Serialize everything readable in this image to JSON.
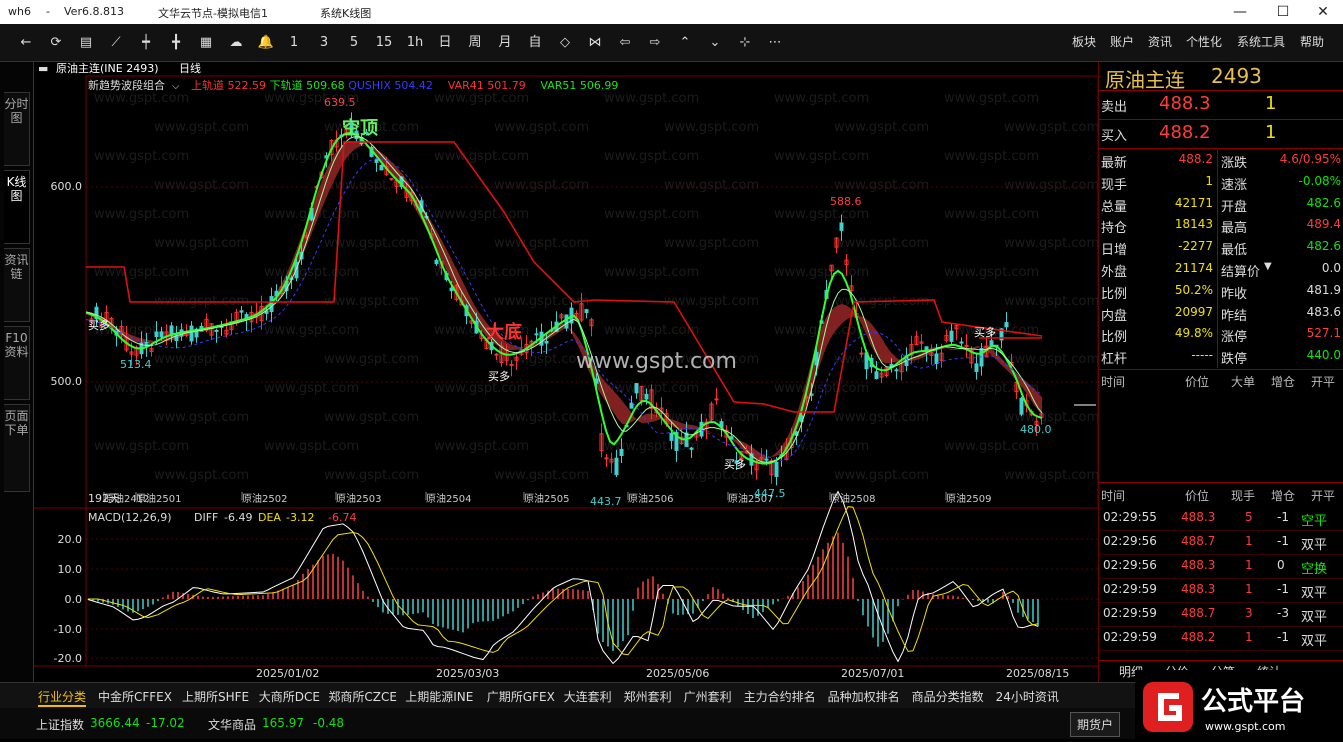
{
  "titlebar": {
    "app": "wh6",
    "sep": "-",
    "version": "Ver6.8.813",
    "server": "文华云节点-模拟电信1",
    "view": "系统K线图"
  },
  "toolbar": {
    "periods": [
      "1",
      "3",
      "5",
      "15",
      "1h",
      "日",
      "周",
      "月",
      "自"
    ],
    "menus": [
      "板块",
      "账户",
      "资讯",
      "个性化",
      "系统工具",
      "帮助"
    ],
    "icons": [
      "back-icon",
      "refresh-icon",
      "list-icon",
      "line-chart-icon",
      "candle-icon",
      "candle2-icon",
      "grid-icon",
      "cloud-icon",
      "bell-icon"
    ],
    "tail_icons": [
      "diamond-left-icon",
      "diamond-right-icon",
      "arrow-left-icon",
      "arrow-right-icon",
      "arrow-up-icon",
      "arrow-down-icon",
      "crosshair-icon",
      "more-icon"
    ]
  },
  "sidetabs": [
    "分时图",
    "K线图",
    "资讯链",
    "F10资料",
    "页面下单"
  ],
  "chart": {
    "symbol": "原油主连(INE 2493)",
    "period": "日线",
    "indicator": "新趋势波段组合",
    "legend": [
      {
        "label": "上轨道",
        "value": "522.59",
        "color": "#ff3030"
      },
      {
        "label": "下轨道",
        "value": "509.68",
        "color": "#20e020"
      },
      {
        "label": "QUSHIX",
        "value": "504.42",
        "color": "#3a3aff"
      },
      {
        "label": "VAR41",
        "value": "501.79",
        "color": "#ff3030"
      },
      {
        "label": "VAR51",
        "value": "506.99",
        "color": "#20e020"
      }
    ],
    "price_labels": [
      "600.0",
      "500.0"
    ],
    "annotations": {
      "high": "639.5",
      "low1": "513.4",
      "low2": "443.7",
      "low3": "447.5",
      "mid_high": "588.6",
      "last": "480.0",
      "top_text": "空顶",
      "bottom_text": "大底",
      "buy": "买多"
    },
    "contracts": [
      "原油2412",
      "原油2501",
      "原油2502",
      "原油2503",
      "原油2504",
      "原油2505",
      "原油2506",
      "原油2507",
      "原油2508",
      "原油2509"
    ],
    "days": "192天",
    "watermark": "www.gspt.com",
    "macd": {
      "label": "MACD(12,26,9)",
      "diff_label": "DIFF",
      "diff": "-6.49",
      "dea_label": "DEA",
      "dea": "-3.12",
      "macd": "-6.74",
      "ticks": [
        "20.0",
        "10.0",
        "0.0",
        "-10.0",
        "-20.0"
      ]
    },
    "dates": [
      "2025/01/02",
      "2025/03/03",
      "2025/05/06",
      "2025/07/01",
      "2025/08/15"
    ]
  },
  "quote": {
    "name": "原油主连",
    "code": "2493",
    "sell_label": "卖出",
    "sell_price": "488.3",
    "sell_vol": "1",
    "buy_label": "买入",
    "buy_price": "488.2",
    "buy_vol": "1",
    "left": [
      {
        "k": "最新",
        "v": "488.2",
        "c": "red"
      },
      {
        "k": "现手",
        "v": "1",
        "c": "yel"
      },
      {
        "k": "总量",
        "v": "42171",
        "c": "yel"
      },
      {
        "k": "持仓",
        "v": "18143",
        "c": "yel"
      },
      {
        "k": "日增",
        "v": "-2277",
        "c": "yel"
      },
      {
        "k": "外盘",
        "v": "21174",
        "c": "yel"
      },
      {
        "k": "比例",
        "v": "50.2%",
        "c": "yel"
      },
      {
        "k": "内盘",
        "v": "20997",
        "c": "yel"
      },
      {
        "k": "比例",
        "v": "49.8%",
        "c": "yel"
      },
      {
        "k": "杠杆",
        "v": "-----",
        "c": "yel"
      }
    ],
    "right": [
      {
        "k": "涨跌",
        "v": "4.6/0.95%",
        "c": "red"
      },
      {
        "k": "速涨",
        "v": "-0.08%",
        "c": "grn"
      },
      {
        "k": "开盘",
        "v": "482.6",
        "c": "grn"
      },
      {
        "k": "最高",
        "v": "489.4",
        "c": "red"
      },
      {
        "k": "最低",
        "v": "482.6",
        "c": "grn"
      },
      {
        "k": "结算价",
        "v": "0.0",
        "c": "wht"
      },
      {
        "k": "昨收",
        "v": "481.9",
        "c": "wht"
      },
      {
        "k": "昨结",
        "v": "483.6",
        "c": "wht"
      },
      {
        "k": "涨停",
        "v": "527.1",
        "c": "red"
      },
      {
        "k": "跌停",
        "v": "440.0",
        "c": "grn"
      }
    ],
    "hdr1": [
      "时间",
      "价位",
      "大单",
      "增仓",
      "开平"
    ],
    "hdr2": [
      "时间",
      "价位",
      "现手",
      "增仓",
      "开平"
    ],
    "trades": [
      {
        "time": "02:29:55",
        "price": "488.3",
        "vol": "5",
        "chg": "-1",
        "type": "空平",
        "pc": "red",
        "tc": "grn"
      },
      {
        "time": "02:29:56",
        "price": "488.7",
        "vol": "1",
        "chg": "-1",
        "type": "双平",
        "pc": "red",
        "tc": "wht"
      },
      {
        "time": "02:29:56",
        "price": "488.3",
        "vol": "1",
        "chg": "0",
        "type": "空换",
        "pc": "red",
        "tc": "grn"
      },
      {
        "time": "02:29:59",
        "price": "488.3",
        "vol": "1",
        "chg": "-1",
        "type": "双平",
        "pc": "red",
        "tc": "wht"
      },
      {
        "time": "02:29:59",
        "price": "488.7",
        "vol": "3",
        "chg": "-3",
        "type": "双平",
        "pc": "red",
        "tc": "wht"
      },
      {
        "time": "02:29:59",
        "price": "488.2",
        "vol": "1",
        "chg": "-1",
        "type": "双平",
        "pc": "red",
        "tc": "wht"
      }
    ],
    "tabs": [
      "明细",
      "分价",
      "分笔",
      "统计"
    ]
  },
  "bottomtabs": [
    "行业分类",
    "中金所CFFEX",
    "上期所SHFE",
    "大商所DCE",
    "郑商所CZCE",
    "上期能源INE",
    "广期所GFEX",
    "大连套利",
    "郑州套利",
    "广州套利",
    "主力合约排名",
    "品种加权排名",
    "商品分类指数",
    "24小时资讯"
  ],
  "status": {
    "sh_label": "上证指数",
    "sh_val": "3666.44",
    "sh_chg": "-17.02",
    "wh_label": "文华商品",
    "wh_val": "165.97",
    "wh_chg": "-0.48",
    "acct": "期货户"
  },
  "logo": {
    "text": "公式平台",
    "url": "www.gspt.com"
  }
}
